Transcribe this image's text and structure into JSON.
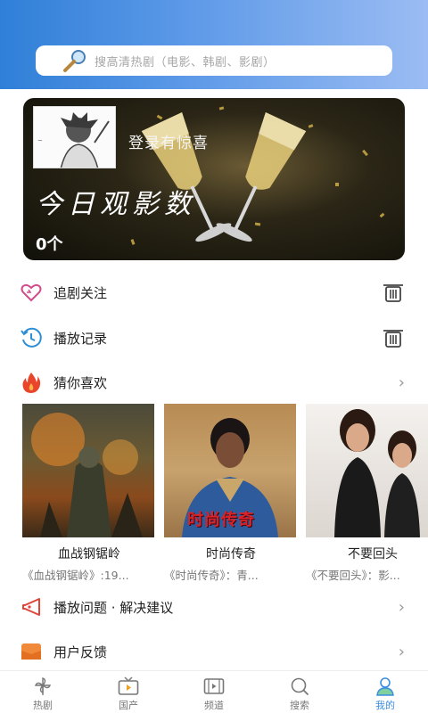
{
  "search": {
    "placeholder": "搜高清热剧（电影、韩剧、影剧）"
  },
  "banner": {
    "login_text": "登录有惊喜",
    "daily_title": "今日观影数",
    "daily_count": "0个"
  },
  "menu": {
    "follow_label": "追剧关注",
    "history_label": "播放记录",
    "guess_label": "猜你喜欢",
    "issue_label": "播放问题 · 解决建议",
    "feedback_label": "用户反馈"
  },
  "recommendations": [
    {
      "title": "血战钢锯岭",
      "desc": "《血战钢锯岭》:19...",
      "poster_tag": ""
    },
    {
      "title": "时尚传奇",
      "desc": "《时尚传奇》：青...",
      "poster_tag": "时尚传奇"
    },
    {
      "title": "不要回头",
      "desc": "《不要回头》：影..."
    }
  ],
  "tabs": [
    {
      "label": "热剧",
      "icon": "pinwheel-icon",
      "active": false
    },
    {
      "label": "国产",
      "icon": "tv-icon",
      "active": false
    },
    {
      "label": "频道",
      "icon": "film-icon",
      "active": false
    },
    {
      "label": "搜索",
      "icon": "search-icon",
      "active": false
    },
    {
      "label": "我的",
      "icon": "user-icon",
      "active": true
    }
  ],
  "colors": {
    "accent": "#3b8de0",
    "header_start": "#2f7fd8",
    "header_end": "#9bbcf3"
  }
}
